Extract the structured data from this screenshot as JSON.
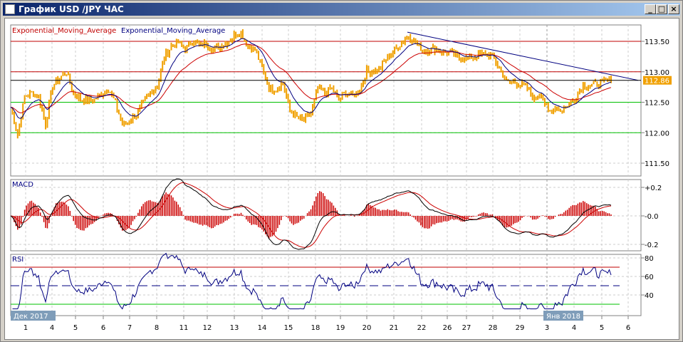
{
  "window": {
    "title": "График USD /JPY  ЧАС",
    "minimize": "_",
    "maximize": "□",
    "close": "×"
  },
  "legend": {
    "ema1": "Exponential_Moving_Average",
    "ema2": "Exponential_Moving_Average"
  },
  "panels": {
    "macd_label": "MACD",
    "rsi_label": "RSI"
  },
  "colors": {
    "price": "#f0a000",
    "ema_fast": "#000080",
    "ema_slow": "#cc0000",
    "level_red": "#c00000",
    "level_green": "#00c000",
    "trend": "#000080"
  },
  "chart_data": {
    "type": "line",
    "title": "USD/JPY hourly",
    "price_axis": {
      "ticks": [
        "113.50",
        "113.00",
        "112.50",
        "112.00",
        "111.50"
      ],
      "values": [
        113.5,
        113.0,
        112.5,
        112.0,
        111.5
      ]
    },
    "current_price": "112.86",
    "current_value": 112.86,
    "levels": [
      {
        "value": 113.5,
        "color": "red"
      },
      {
        "value": 113.0,
        "color": "red"
      },
      {
        "value": 112.5,
        "color": "green"
      },
      {
        "value": 112.0,
        "color": "green"
      }
    ],
    "trendline": {
      "from": 113.65,
      "to": 112.86
    },
    "macd_axis": {
      "ticks": [
        "+0.2",
        "-0.0",
        "-0.2"
      ],
      "values": [
        0.2,
        0,
        -0.2
      ]
    },
    "rsi_axis": {
      "ticks": [
        "80",
        "60",
        "40"
      ],
      "values": [
        80,
        60,
        40
      ],
      "levels": [
        70,
        50,
        30
      ]
    },
    "x_labels": [
      "1",
      "4",
      "5",
      "6",
      "7",
      "8",
      "11",
      "12",
      "13",
      "14",
      "15",
      "18",
      "19",
      "20",
      "21",
      "22",
      "26",
      "27",
      "28",
      "29",
      "3",
      "4",
      "5",
      "6"
    ],
    "period_labels": [
      "Дек 2017",
      "Янв 2018"
    ],
    "close": [
      112.42,
      111.96,
      112.6,
      112.66,
      112.6,
      112.13,
      112.77,
      112.9,
      113.0,
      112.65,
      112.54,
      112.54,
      112.54,
      112.65,
      112.72,
      112.49,
      112.13,
      112.19,
      112.3,
      112.48,
      112.66,
      112.77,
      113.24,
      113.42,
      113.48,
      113.36,
      113.53,
      113.42,
      113.48,
      113.36,
      113.42,
      113.48,
      113.6,
      113.65,
      113.42,
      113.36,
      113.07,
      112.72,
      112.72,
      112.83,
      112.37,
      112.25,
      112.19,
      112.31,
      112.72,
      112.66,
      112.72,
      112.54,
      112.66,
      112.6,
      112.72,
      113.01,
      113.01,
      113.07,
      113.24,
      113.36,
      113.48,
      113.6,
      113.48,
      113.36,
      113.36,
      113.38,
      113.33,
      113.3,
      113.24,
      113.22,
      113.24,
      113.27,
      113.3,
      113.24,
      113.07,
      112.83,
      112.83,
      112.8,
      112.72,
      112.54,
      112.66,
      112.31,
      112.42,
      112.37,
      112.48,
      112.6,
      112.77,
      112.77,
      112.8,
      112.83,
      112.86
    ]
  }
}
